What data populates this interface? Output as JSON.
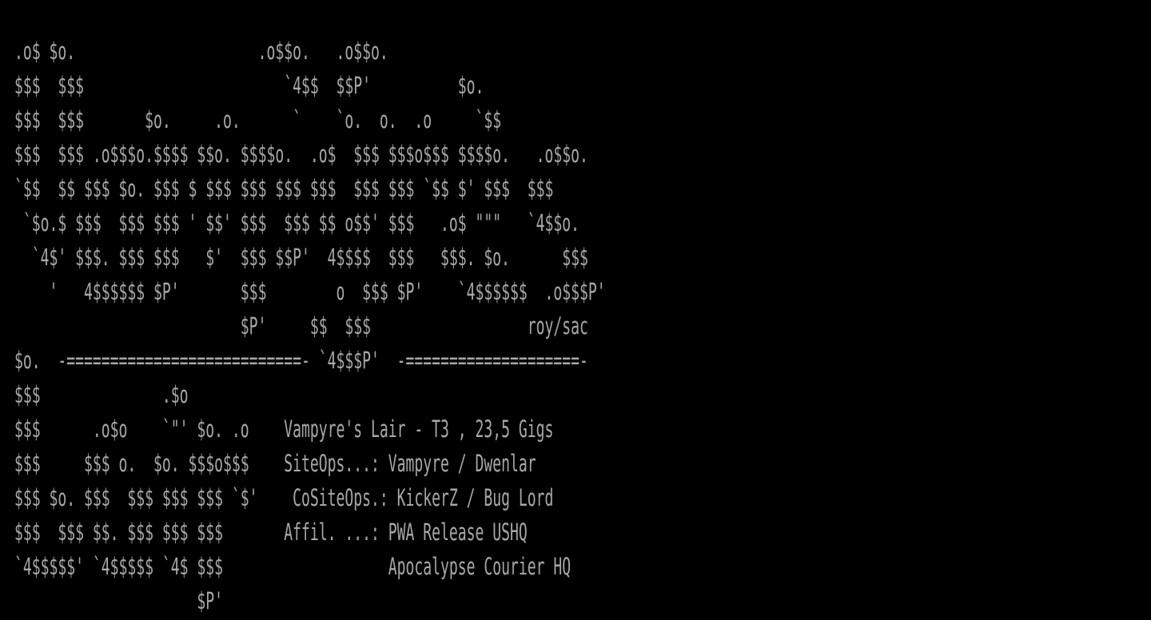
{
  "screen": {
    "background_color": "#000000",
    "text_color": "#a8a8a8",
    "lines": [
      "",
      ".o$ $o.                     .o$$o.   .o$$o.",
      "$$$  $$$                       `4$$  $$P'          $o.",
      "$$$  $$$       $o.     .o.      `    `o.  o.  .o     `$$",
      "$$$  $$$ .o$$$o.$$$$ $$o. $$$$o.  .o$  $$$ $$$o$$$ $$$$o.   .o$$o.",
      "`$$  $$ $$$ $o. $$$ $ $$$ $$$ $$$ $$$  $$$ $$$ `$$ $' $$$  $$$",
      " `$o.$ $$$  $$$ $$$ ' $$' $$$  $$$ $$ o$$' $$$   .o$ \"\"\"   `4$$o.",
      "  `4$' $$$. $$$ $$$   $'  $$$ $$P'  4$$$$  $$$   $$$. $o.      $$$",
      "    '   4$$$$$$ $P'       $$$        o  $$$ $P'    `4$$$$$$  .o$$$P'",
      "                          $P'     $$  $$$                  roy/sac",
      "$o.  -===========================- `4$$$P'  -====================-",
      "$$$              .$o",
      "$$$      .o$o    `\"' $o. .o    Vampyre's Lair - T3 , 23,5 Gigs",
      "$$$     $$$ o.  $o. $$$o$$$    SiteOps...: Vampyre / Dwenlar",
      "$$$ $o. $$$  $$$ $$$ $$$ `$'    CoSiteOps.: KickerZ / Bug Lord",
      "$$$  $$$ $$. $$$ $$$ $$$       Affil. ...: PWA Release USHQ",
      "`4$$$$$' `4$$$$$ `4$ $$$                   Apocalypse Courier HQ",
      "                     $P'"
    ]
  }
}
